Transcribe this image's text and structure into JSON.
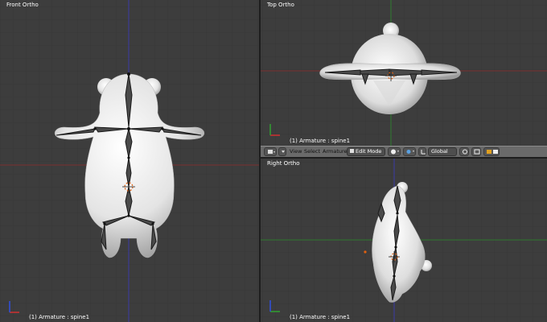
{
  "viewports": {
    "front": {
      "title": "Front Ortho",
      "info": "(1) Armature : spine1"
    },
    "top": {
      "title": "Top Ortho",
      "info": "(1) Armature : spine1"
    },
    "right": {
      "title": "Right Ortho",
      "info": "(1) Armature : spine1"
    }
  },
  "toolbar": {
    "view_label": "View",
    "select_label": "Select",
    "armature_label": "Armature",
    "mode_value": "Edit Mode",
    "orientation_value": "Global"
  },
  "icons": [
    "editor-type-icon",
    "menu-toggle-icon",
    "mode-icon",
    "shading-sphere-icon",
    "pivot-icon",
    "manipulator-icon",
    "transform-icon",
    "snap-icon",
    "layer-icon",
    "render-preview-icon",
    "axis-gizmo-icon",
    "bone-icon",
    "3d-cursor-icon"
  ],
  "colors": {
    "viewport_bg": "#3d3d3d",
    "grid_line": "#363636",
    "x_axis": "#8a3232",
    "y_axis": "#2f7a2f",
    "z_axis": "#3a3aa8",
    "toolbar_bg": "#6a6a6a",
    "bone_dark": "#2a2a2a",
    "mesh": "#e8e8e8"
  }
}
